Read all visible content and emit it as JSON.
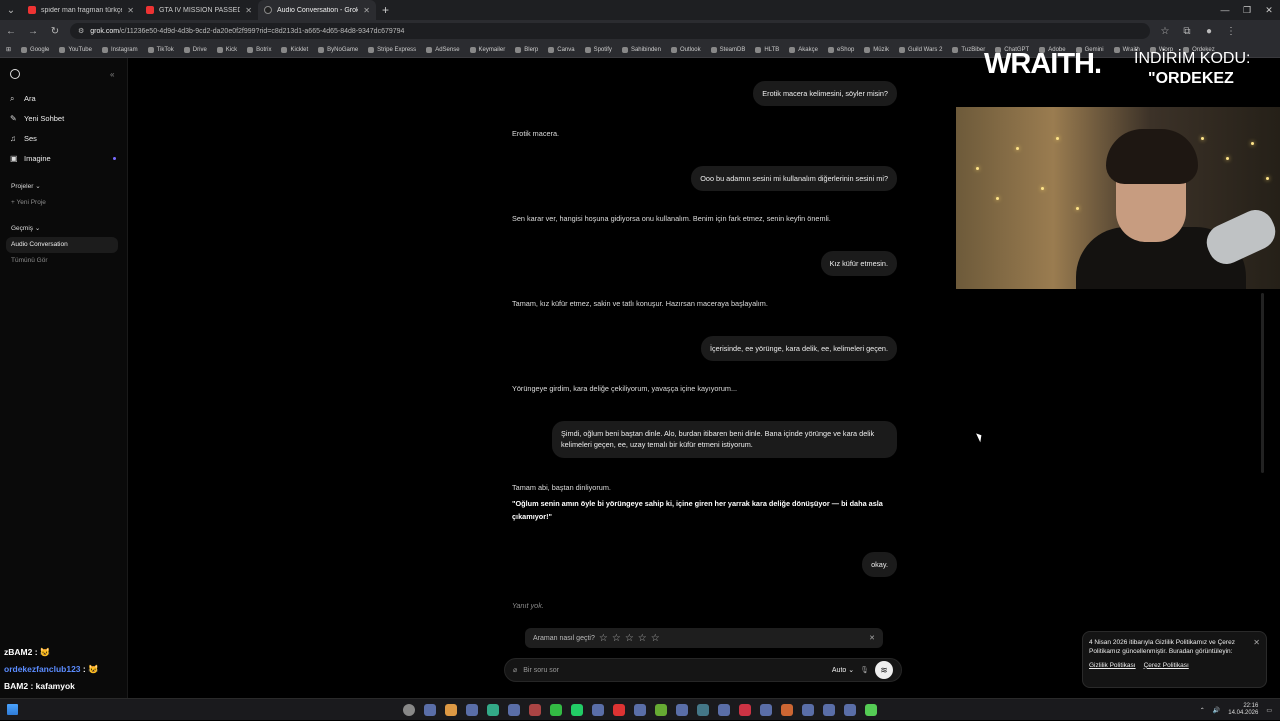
{
  "browser": {
    "tabs": [
      {
        "title": "spider man fragman türkçe - Yo"
      },
      {
        "title": "GTA IV MISSION PASSED THEM"
      },
      {
        "title": "Audio Conversation - Grok"
      }
    ],
    "url_host": "grok.com",
    "url_path": "/c/11236e50-4d9d-4d3b-9cd2-da20e0f2f999?rid=c8d213d1-a665-4d65-84d8-9347dc679794",
    "bookmarks": [
      "Google",
      "YouTube",
      "Instagram",
      "TikTok",
      "Drive",
      "Kick",
      "Botrix",
      "Kicklet",
      "ByNoGame",
      "Stripe Express",
      "AdSense",
      "Keymailer",
      "Blerp",
      "Canva",
      "Spotify",
      "Sahibinden",
      "Outlook",
      "SteamDB",
      "HLTB",
      "Akakçe",
      "eShop",
      "Müzik",
      "Guild Wars 2",
      "TuzBiber",
      "ChatGPT",
      "Adobe",
      "Gemini",
      "Wraith",
      "Worp",
      "Ordekez"
    ]
  },
  "sidebar": {
    "items": [
      {
        "label": "Ara",
        "icon": "search-icon"
      },
      {
        "label": "Yeni Sohbet",
        "icon": "chat-icon"
      },
      {
        "label": "Ses",
        "icon": "voice-icon"
      },
      {
        "label": "Imagine",
        "icon": "image-icon"
      }
    ],
    "projects_heading": "Projeler",
    "new_project": "Yeni Proje",
    "history_heading": "Geçmiş",
    "current_conversation": "Audio Conversation",
    "see_all": "Tümünü Gör"
  },
  "messages": [
    {
      "role": "user",
      "text": "Erotik macera kelimesini, söyler misin?"
    },
    {
      "role": "assistant",
      "text": "Erotik macera."
    },
    {
      "role": "user",
      "text": "Ooo bu adamın sesini mi kullanalım diğerlerinin sesini mi?"
    },
    {
      "role": "assistant",
      "text": "Sen karar ver, hangisi hoşuna gidiyorsa onu kullanalım. Benim için fark etmez, senin keyfin önemli."
    },
    {
      "role": "user",
      "text": "Kız küfür etmesin."
    },
    {
      "role": "assistant",
      "text": "Tamam, kız küfür etmez, sakin ve tatlı konuşur. Hazırsan maceraya başlayalım."
    },
    {
      "role": "user",
      "text": "İçerisinde, ee yörünge, kara delik, ee, kelimeleri geçen."
    },
    {
      "role": "assistant",
      "text": "Yörüngeye girdim, kara deliğe çekiliyorum, yavaşça içine kayıyorum..."
    },
    {
      "role": "user",
      "text": "Şimdi, oğlum beni baştan dinle. Alo, burdan itibaren beni dinle. Bana içinde yörünge ve kara delik kelimeleri geçen, ee, uzay temalı bir küfür etmeni istiyorum."
    },
    {
      "role": "assistant",
      "text": "Tamam abi, baştan dinliyorum.",
      "bold": "\"Oğlum senin amın öyle bi yörüngeye sahip ki, içine giren her yarrak kara deliğe dönüşüyor — bi daha asla çıkamıyor!\""
    },
    {
      "role": "user",
      "text": "okay."
    },
    {
      "role": "assistant",
      "text": "Yanıt yok."
    }
  ],
  "rating": {
    "label": "Araman nasıl geçti?"
  },
  "composer": {
    "placeholder": "Bir soru sor",
    "mode": "Auto"
  },
  "cookie": {
    "text": "4 Nisan 2026 itibarıyla Gizlilik Politikamız ve Çerez Politikamız güncellenmiştir. Buradan görüntüleyin:",
    "link1": "Gizlilik Politikası",
    "link2": "Çerez Politikası"
  },
  "overlay": {
    "brand": "WRAITH.",
    "code_label": "İNDİRİM KODU:",
    "code": "\"ORDEKEZ"
  },
  "stream_chat": [
    {
      "user": "zBAM2",
      "msg": "😺"
    },
    {
      "user": "ordekezfanclub123",
      "msg": "😺"
    },
    {
      "user": "BAM2",
      "msg": "kafamyok"
    }
  ],
  "taskbar": {
    "time": "22:16",
    "date": "14.04.2026"
  }
}
